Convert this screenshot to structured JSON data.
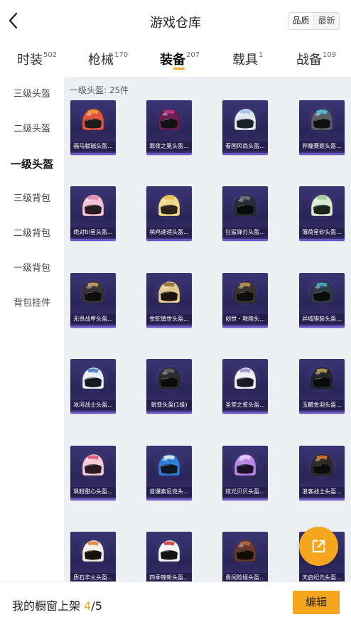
{
  "header": {
    "title": "游戏仓库",
    "sort_options": [
      "品质",
      "最新"
    ],
    "selected_sort": "品质"
  },
  "tabs": [
    {
      "label": "时装",
      "count": "502"
    },
    {
      "label": "枪械",
      "count": "170"
    },
    {
      "label": "装备",
      "count": "207"
    },
    {
      "label": "载具",
      "count": "1"
    },
    {
      "label": "战备",
      "count": "109"
    }
  ],
  "active_tab": "装备",
  "sidebar": {
    "items": [
      "三级头盔",
      "二级头盔",
      "一级头盔",
      "三级背包",
      "二级背包",
      "一级背包",
      "背包挂件"
    ],
    "active": "一级头盔"
  },
  "section": {
    "title": "一级头盔: 25件"
  },
  "items": [
    {
      "name": "福马献瑞头盔...",
      "color": "#e2543c",
      "accent": "#f2a03a",
      "visor": "#1c1c1c"
    },
    {
      "name": "罪夜之冕头盔...",
      "color": "#6a1e56",
      "accent": "#c43d8a",
      "visor": "#111111"
    },
    {
      "name": "看国风尚头盔...",
      "color": "#dfe7ef",
      "accent": "#9cc6e6",
      "visor": "#182028"
    },
    {
      "name": "异瞳赛姬头盔...",
      "color": "#5c5f68",
      "accent": "#4fc8e0",
      "visor": "#111111"
    },
    {
      "name": "绝对til星头盔...",
      "color": "#f4c3d4",
      "accent": "#e084a8",
      "visor": "#2a1a22"
    },
    {
      "name": "萌鸡速递头盔...",
      "color": "#f0d98a",
      "accent": "#e6b94c",
      "visor": "#2a2418"
    },
    {
      "name": "狂鲨锋刃头盔...",
      "color": "#2a2d33",
      "accent": "#6b7584",
      "visor": "#0a0a0a"
    },
    {
      "name": "薄荷星砂头盔...",
      "color": "#d8ecd2",
      "accent": "#9ccd9a",
      "visor": "#1c241c"
    },
    {
      "name": "无畏战甲头盔...",
      "color": "#3a3532",
      "accent": "#c9a46a",
      "visor": "#0d0d0d"
    },
    {
      "name": "金蛇镇世头盔...",
      "color": "#e4c98c",
      "accent": "#8b6a34",
      "visor": "#1a1510"
    },
    {
      "name": "创世・救赎头...",
      "color": "#3b3530",
      "accent": "#c49a55",
      "visor": "#0e0e0e"
    },
    {
      "name": "异域猎装头盔...",
      "color": "#2e3e45",
      "accent": "#46b3c9",
      "visor": "#0c0c0c"
    },
    {
      "name": "冰河战士头盔...",
      "color": "#e6eef4",
      "accent": "#3a78c2",
      "visor": "#131a22"
    },
    {
      "name": "蜕变头盔(1级)",
      "color": "#2d2d2d",
      "accent": "#6a6a6a",
      "visor": "#0b0b0b"
    },
    {
      "name": "圣堂之誓头盔...",
      "color": "#f0eef3",
      "accent": "#9c8ad0",
      "visor": "#1b1826"
    },
    {
      "name": "玉麟金羽头盔...",
      "color": "#23262c",
      "accent": "#c7a355",
      "visor": "#0b0b0b"
    },
    {
      "name": "飒粉甜心头盔...",
      "color": "#f5cbd8",
      "accent": "#e04f75",
      "visor": "#2a1a20"
    },
    {
      "name": "音爆索尼克头...",
      "color": "#2f7fd6",
      "accent": "#f2f2f2",
      "visor": "#0f1622"
    },
    {
      "name": "炫光贝贝头盔...",
      "color": "#b888e6",
      "accent": "#f0d0ff",
      "visor": "#1a1226"
    },
    {
      "name": "浪客战士头盔...",
      "color": "#2f2a26",
      "accent": "#e4792a",
      "visor": "#0c0c0c"
    },
    {
      "name": "质石华火头盔...",
      "color": "#f1eee6",
      "accent": "#e4792a",
      "visor": "#16120e"
    },
    {
      "name": "四季锦新头盔...",
      "color": "#f3f3f3",
      "accent": "#c8362e",
      "visor": "#141414"
    },
    {
      "name": "勇闯险境头盔...",
      "color": "#6a3a2c",
      "accent": "#b66a4c",
      "visor": "#120c0a"
    },
    {
      "name": "天启纪元头盔...",
      "color": "#3c3630",
      "accent": "#d09a4a",
      "visor": "#0e0e0e"
    }
  ],
  "footer": {
    "label": "我的橱窗上架",
    "current": "4",
    "separator": "/",
    "total": "5",
    "edit_label": "编辑"
  },
  "colors": {
    "accent": "#f5a51e",
    "card_bg": "#2d2860",
    "content_bg": "#edf0f3"
  },
  "icons": {
    "back": "chevron-left-icon",
    "share": "share-external-icon"
  }
}
